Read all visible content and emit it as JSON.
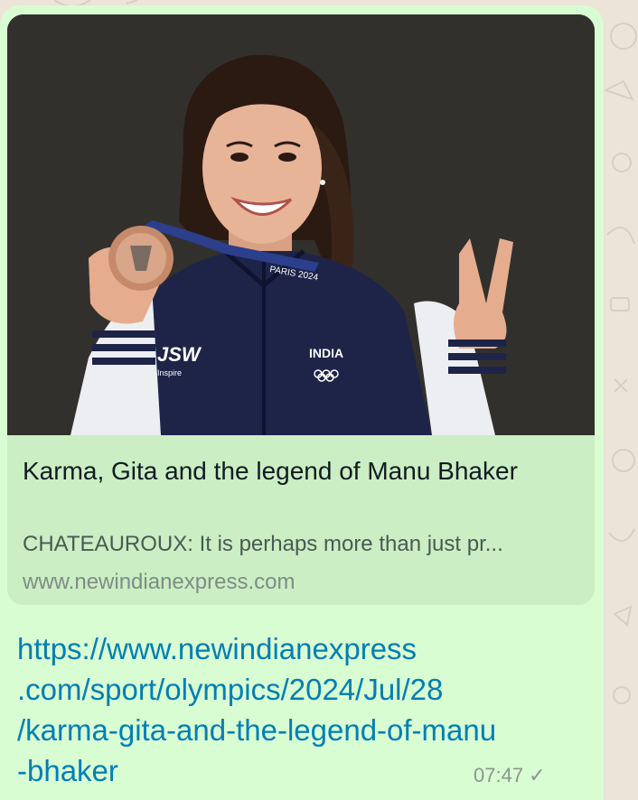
{
  "link_preview": {
    "title": "Karma, Gita and the legend of Manu Bhaker",
    "description": "CHATEAUROUX: It is perhaps more than just pr...",
    "domain": "www.newindianexpress.com",
    "image_alt": "Manu Bhaker holding Paris 2024 bronze medal",
    "image_text": {
      "jacket_sponsor": "JSW",
      "jacket_sponsor_sub": "Inspire",
      "jacket_country": "INDIA",
      "lanyard": "PARIS 2024"
    }
  },
  "message": {
    "link_lines": [
      "https://www.newindianexpress",
      ".com/sport/olympics/2024/Jul/28",
      "/karma-gita-and-the-legend-of-manu",
      "-bhaker"
    ],
    "time": "07:47",
    "status_icon": "single-check-icon"
  },
  "colors": {
    "bubble": "#d9fdd3",
    "link": "#027eb5",
    "wallpaper": "#ece4d8"
  }
}
